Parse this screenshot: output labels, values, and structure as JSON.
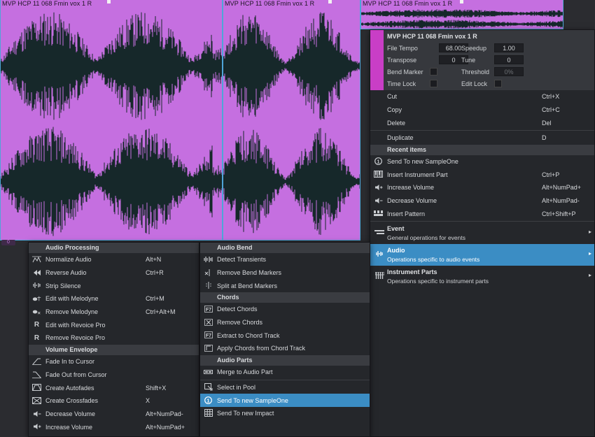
{
  "events": [
    {
      "title": "MVP HCP 11 068 Fmin vox 1 R"
    },
    {
      "title": "MVP HCP 11 068 Fmin vox 1 R"
    },
    {
      "title": "MVP HCP 11 068 Fmin vox 1 R"
    }
  ],
  "event_marker": "0",
  "event_header": {
    "title": "MVP HCP 11 068 Fmin vox 1 R",
    "file_tempo_label": "File Tempo",
    "file_tempo_value": "68.00",
    "speedup_label": "Speedup",
    "speedup_value": "1.00",
    "transpose_label": "Transpose",
    "transpose_value": "0",
    "tune_label": "Tune",
    "tune_value": "0",
    "bend_marker_label": "Bend Marker",
    "threshold_label": "Threshold",
    "threshold_value": "0%",
    "time_lock_label": "Time Lock",
    "edit_lock_label": "Edit Lock"
  },
  "context_menu": {
    "edit_items": [
      {
        "label": "Cut",
        "shortcut": "Ctrl+X"
      },
      {
        "label": "Copy",
        "shortcut": "Ctrl+C"
      },
      {
        "label": "Delete",
        "shortcut": "Del"
      }
    ],
    "duplicate": {
      "label": "Duplicate",
      "shortcut": "D"
    },
    "recent_header": "Recent items",
    "recent_items": [
      {
        "label": "Send To new SampleOne",
        "shortcut": "",
        "icon": "sampleone-icon"
      },
      {
        "label": "Insert Instrument Part",
        "shortcut": "Ctrl+P",
        "icon": "keyboard-icon"
      },
      {
        "label": "Increase Volume",
        "shortcut": "Alt+NumPad+",
        "icon": "volume-up-icon"
      },
      {
        "label": "Decrease Volume",
        "shortcut": "Alt+NumPad-",
        "icon": "volume-down-icon"
      },
      {
        "label": "Insert Pattern",
        "shortcut": "Ctrl+Shift+P",
        "icon": "pattern-icon"
      }
    ],
    "categories": [
      {
        "title": "Event",
        "desc": "General operations for events",
        "icon": "event-icon"
      },
      {
        "title": "Audio",
        "desc": "Operations specific to audio events",
        "icon": "audio-wave-icon"
      },
      {
        "title": "Instrument Parts",
        "desc": "Operations specific to instrument parts",
        "icon": "instrument-parts-icon"
      }
    ]
  },
  "audio_submenu_left": {
    "audio_processing_header": "Audio Processing",
    "audio_processing": [
      {
        "label": "Normalize Audio",
        "shortcut": "Alt+N",
        "icon": "normalize-icon"
      },
      {
        "label": "Reverse Audio",
        "shortcut": "Ctrl+R",
        "icon": "reverse-icon"
      },
      {
        "label": "Strip Silence",
        "shortcut": "",
        "icon": "strip-silence-icon"
      },
      {
        "label": "Edit with Melodyne",
        "shortcut": "Ctrl+M",
        "icon": "melodyne-icon"
      },
      {
        "label": "Remove Melodyne",
        "shortcut": "Ctrl+Alt+M",
        "icon": "melodyne-remove-icon"
      },
      {
        "label": "Edit with Revoice Pro",
        "shortcut": "",
        "icon": "revoice-icon"
      },
      {
        "label": "Remove Revoice Pro",
        "shortcut": "",
        "icon": "revoice-remove-icon"
      }
    ],
    "volume_envelope_header": "Volume Envelope",
    "volume_envelope": [
      {
        "label": "Fade In to Cursor",
        "shortcut": "",
        "icon": "fade-in-icon"
      },
      {
        "label": "Fade Out from Cursor",
        "shortcut": "",
        "icon": "fade-out-icon"
      },
      {
        "label": "Create Autofades",
        "shortcut": "Shift+X",
        "icon": "autofade-icon"
      },
      {
        "label": "Create Crossfades",
        "shortcut": "X",
        "icon": "crossfade-icon"
      },
      {
        "label": "Decrease Volume",
        "shortcut": "Alt+NumPad-",
        "icon": "volume-down-icon"
      },
      {
        "label": "Increase Volume",
        "shortcut": "Alt+NumPad+",
        "icon": "volume-up-icon"
      }
    ]
  },
  "audio_submenu_right": {
    "audio_bend_header": "Audio Bend",
    "audio_bend": [
      {
        "label": "Detect Transients",
        "icon": "transients-icon"
      },
      {
        "label": "Remove Bend Markers",
        "icon": "remove-bend-icon"
      },
      {
        "label": "Split at Bend Markers",
        "icon": "split-bend-icon"
      }
    ],
    "chords_header": "Chords",
    "chords": [
      {
        "label": "Detect Chords",
        "icon": "chord-f7-icon"
      },
      {
        "label": "Remove Chords",
        "icon": "chord-remove-icon"
      },
      {
        "label": "Extract to Chord Track",
        "icon": "chord-f7-icon"
      },
      {
        "label": "Apply Chords from Chord Track",
        "icon": "chord-apply-icon"
      }
    ],
    "audio_parts_header": "Audio Parts",
    "audio_parts": [
      {
        "label": "Merge to Audio Part",
        "icon": "merge-icon"
      },
      {
        "label": "Select in Pool",
        "icon": "pool-icon"
      },
      {
        "label": "Send To new SampleOne",
        "icon": "sampleone-icon"
      },
      {
        "label": "Send To new Impact",
        "icon": "impact-icon"
      }
    ]
  },
  "colors": {
    "event_fill": "#c56fe0",
    "waveform": "#16282a",
    "selection": "#3b8dc4",
    "event_swatch": "#c93ec6"
  }
}
